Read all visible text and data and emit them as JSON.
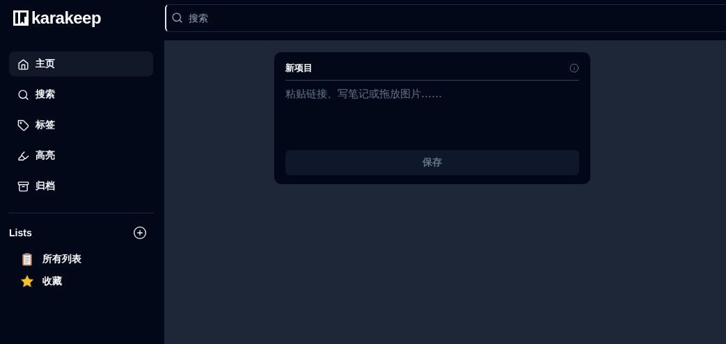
{
  "app": {
    "name": "karakeep"
  },
  "search": {
    "placeholder": "搜索"
  },
  "sidebar": {
    "items": [
      {
        "label": "主页",
        "selected": true
      },
      {
        "label": "搜索",
        "selected": false
      },
      {
        "label": "标签",
        "selected": false
      },
      {
        "label": "高亮",
        "selected": false
      },
      {
        "label": "归档",
        "selected": false
      }
    ],
    "lists_heading": "Lists",
    "lists": [
      {
        "label": "所有列表"
      },
      {
        "label": "收藏"
      }
    ]
  },
  "new_item": {
    "title": "新项目",
    "placeholder": "粘贴链接、写笔记或拖放图片……",
    "save": {
      "label": "保存",
      "disabled": true
    }
  }
}
